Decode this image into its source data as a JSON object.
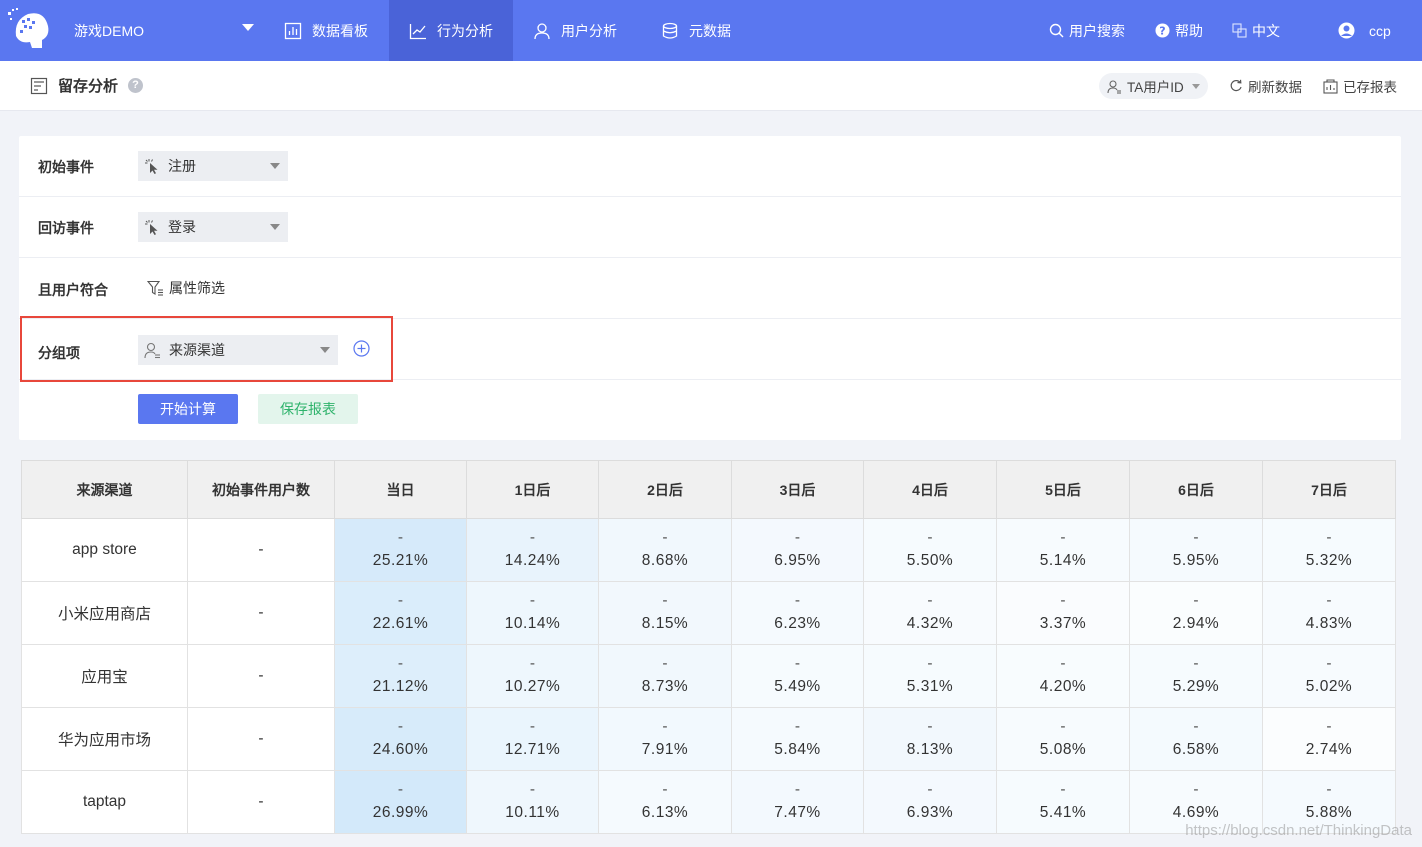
{
  "topbar": {
    "project": "游戏DEMO",
    "nav": [
      "数据看板",
      "行为分析",
      "用户分析",
      "元数据"
    ],
    "active_nav": 1,
    "tools": [
      "用户搜索",
      "帮助",
      "中文",
      "ccp"
    ],
    "accent": "#5a77f0"
  },
  "subheader": {
    "title": "留存分析",
    "help": "?",
    "id_selector": "TA用户ID",
    "refresh": "刷新数据",
    "saved_reports": "已存报表"
  },
  "config": {
    "initial_event_label": "初始事件",
    "initial_event_value": "注册",
    "return_event_label": "回访事件",
    "return_event_value": "登录",
    "user_filter_label": "且用户符合",
    "filter_button": "属性筛选",
    "group_label": "分组项",
    "group_value": "来源渠道",
    "start_button": "开始计算",
    "save_button": "保存报表"
  },
  "table": {
    "headers": [
      "来源渠道",
      "初始事件用户数",
      "当日",
      "1日后",
      "2日后",
      "3日后",
      "4日后",
      "5日后",
      "6日后",
      "7日后"
    ],
    "rows": [
      {
        "name": "app store",
        "users": "-",
        "cells": [
          [
            "-",
            "25.21%"
          ],
          [
            "-",
            "14.24%"
          ],
          [
            "-",
            "8.68%"
          ],
          [
            "-",
            "6.95%"
          ],
          [
            "-",
            "5.50%"
          ],
          [
            "-",
            "5.14%"
          ],
          [
            "-",
            "5.95%"
          ],
          [
            "-",
            "5.32%"
          ]
        ]
      },
      {
        "name": "小米应用商店",
        "users": "-",
        "cells": [
          [
            "-",
            "22.61%"
          ],
          [
            "-",
            "10.14%"
          ],
          [
            "-",
            "8.15%"
          ],
          [
            "-",
            "6.23%"
          ],
          [
            "-",
            "4.32%"
          ],
          [
            "-",
            "3.37%"
          ],
          [
            "-",
            "2.94%"
          ],
          [
            "-",
            "4.83%"
          ]
        ]
      },
      {
        "name": "应用宝",
        "users": "-",
        "cells": [
          [
            "-",
            "21.12%"
          ],
          [
            "-",
            "10.27%"
          ],
          [
            "-",
            "8.73%"
          ],
          [
            "-",
            "5.49%"
          ],
          [
            "-",
            "5.31%"
          ],
          [
            "-",
            "4.20%"
          ],
          [
            "-",
            "5.29%"
          ],
          [
            "-",
            "5.02%"
          ]
        ]
      },
      {
        "name": "华为应用市场",
        "users": "-",
        "cells": [
          [
            "-",
            "24.60%"
          ],
          [
            "-",
            "12.71%"
          ],
          [
            "-",
            "7.91%"
          ],
          [
            "-",
            "5.84%"
          ],
          [
            "-",
            "8.13%"
          ],
          [
            "-",
            "5.08%"
          ],
          [
            "-",
            "6.58%"
          ],
          [
            "-",
            "2.74%"
          ]
        ]
      },
      {
        "name": "taptap",
        "users": "-",
        "cells": [
          [
            "-",
            "26.99%"
          ],
          [
            "-",
            "10.11%"
          ],
          [
            "-",
            "6.13%"
          ],
          [
            "-",
            "7.47%"
          ],
          [
            "-",
            "6.93%"
          ],
          [
            "-",
            "5.41%"
          ],
          [
            "-",
            "4.69%"
          ],
          [
            "-",
            "5.88%"
          ]
        ]
      }
    ]
  },
  "watermark": "https://blog.csdn.net/ThinkingData"
}
